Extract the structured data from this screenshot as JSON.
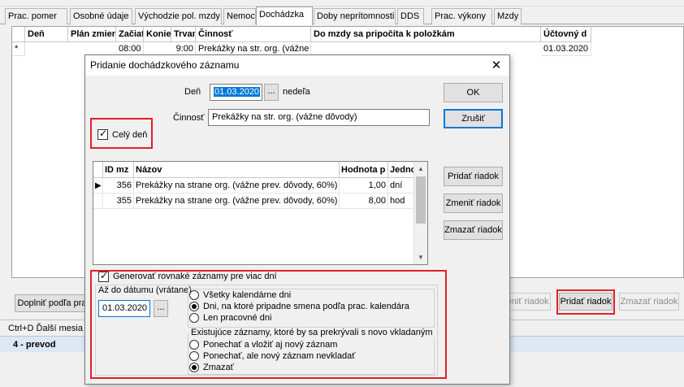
{
  "tabs": [
    {
      "label": "Prac. pomer"
    },
    {
      "label": "Osobné údaje"
    },
    {
      "label": "Východzie pol. mzdy"
    },
    {
      "label": "Nemoc"
    },
    {
      "label": "Dochádzka"
    },
    {
      "label": "Doby neprítomnosti"
    },
    {
      "label": "DDS"
    },
    {
      "label": "Prac. výkony"
    },
    {
      "label": "Mzdy"
    }
  ],
  "grid": {
    "headers": {
      "den": "Deň",
      "plan": "Plán zmien",
      "zaciatok": "Začiat",
      "koniec": "Koniec",
      "trvanie": "Trvani",
      "cinnost": "Činnosť",
      "do_mzdy": "Do mzdy sa pripočíta k položkám",
      "uctovny": "Účtovný d"
    },
    "row": {
      "marker": "*",
      "zaciatok": "08:00",
      "koniec": "9:00",
      "cinnost": "Prekážky na str. org. (vážne d",
      "uctovny": "01.03.2020"
    }
  },
  "background_buttons": {
    "doplnit": "Doplniť podľa pra",
    "zmenit_partial": "meniť riadok",
    "pridat": "Pridať riadok",
    "zmazat": "Zmazať riadok"
  },
  "status": {
    "shortcut": "Ctrl+D Ďalší mesia",
    "bottom": "4 - prevod"
  },
  "dialog": {
    "title": "Pridanie dochádzkového záznamu",
    "close_glyph": "✕",
    "den_label": "Deň",
    "den_value": "01.03.2020",
    "den_dow": "nedeľa",
    "dots": "...",
    "cinnost_label": "Činnosť",
    "cinnost_value": "Prekážky na str. org. (vážne dôvody)",
    "cely_den_label": "Celý deň",
    "ok": "OK",
    "zrusit": "Zrušiť",
    "pridat_riadok": "Pridať riadok",
    "zmenit_riadok": "Zmeniť riadok",
    "zmazat_riadok": "Zmazať riadok",
    "table": {
      "headers": {
        "id": "ID mz",
        "nazov": "Názov",
        "hodnota": "Hodnota p",
        "jednotka": "Jedno"
      },
      "rows": [
        {
          "marker": "▶",
          "id": "356",
          "nazov": "Prekážky na strane org. (vážne prev. dôvody, 60%) -",
          "hodnota": "1,00",
          "jednotka": "dní"
        },
        {
          "marker": "",
          "id": "355",
          "nazov": "Prekážky na strane org. (vážne prev. dôvody, 60%) -",
          "hodnota": "8,00",
          "jednotka": "hod"
        }
      ]
    },
    "generate": {
      "checkbox_label": "Generovať rovnaké záznamy pre viac dní",
      "az_do_label": "Až do dátumu (vrátane)",
      "az_do_value": "01.03.2020",
      "days_options": [
        {
          "label": "Všetky kalendárne dni",
          "selected": false
        },
        {
          "label": "Dni, na ktoré pripadne smena podľa prac. kalendára",
          "selected": true
        },
        {
          "label": "Len pracovné dni",
          "selected": false
        }
      ],
      "overlap_title": "Existujúce záznamy, ktoré by sa prekrývali s novo vkladaným",
      "overlap_options": [
        {
          "label": "Ponechať a vložiť aj nový záznam",
          "selected": false
        },
        {
          "label": "Ponechať, ale nový záznam nevkladať",
          "selected": false
        },
        {
          "label": "Zmazať",
          "selected": true
        }
      ]
    }
  }
}
